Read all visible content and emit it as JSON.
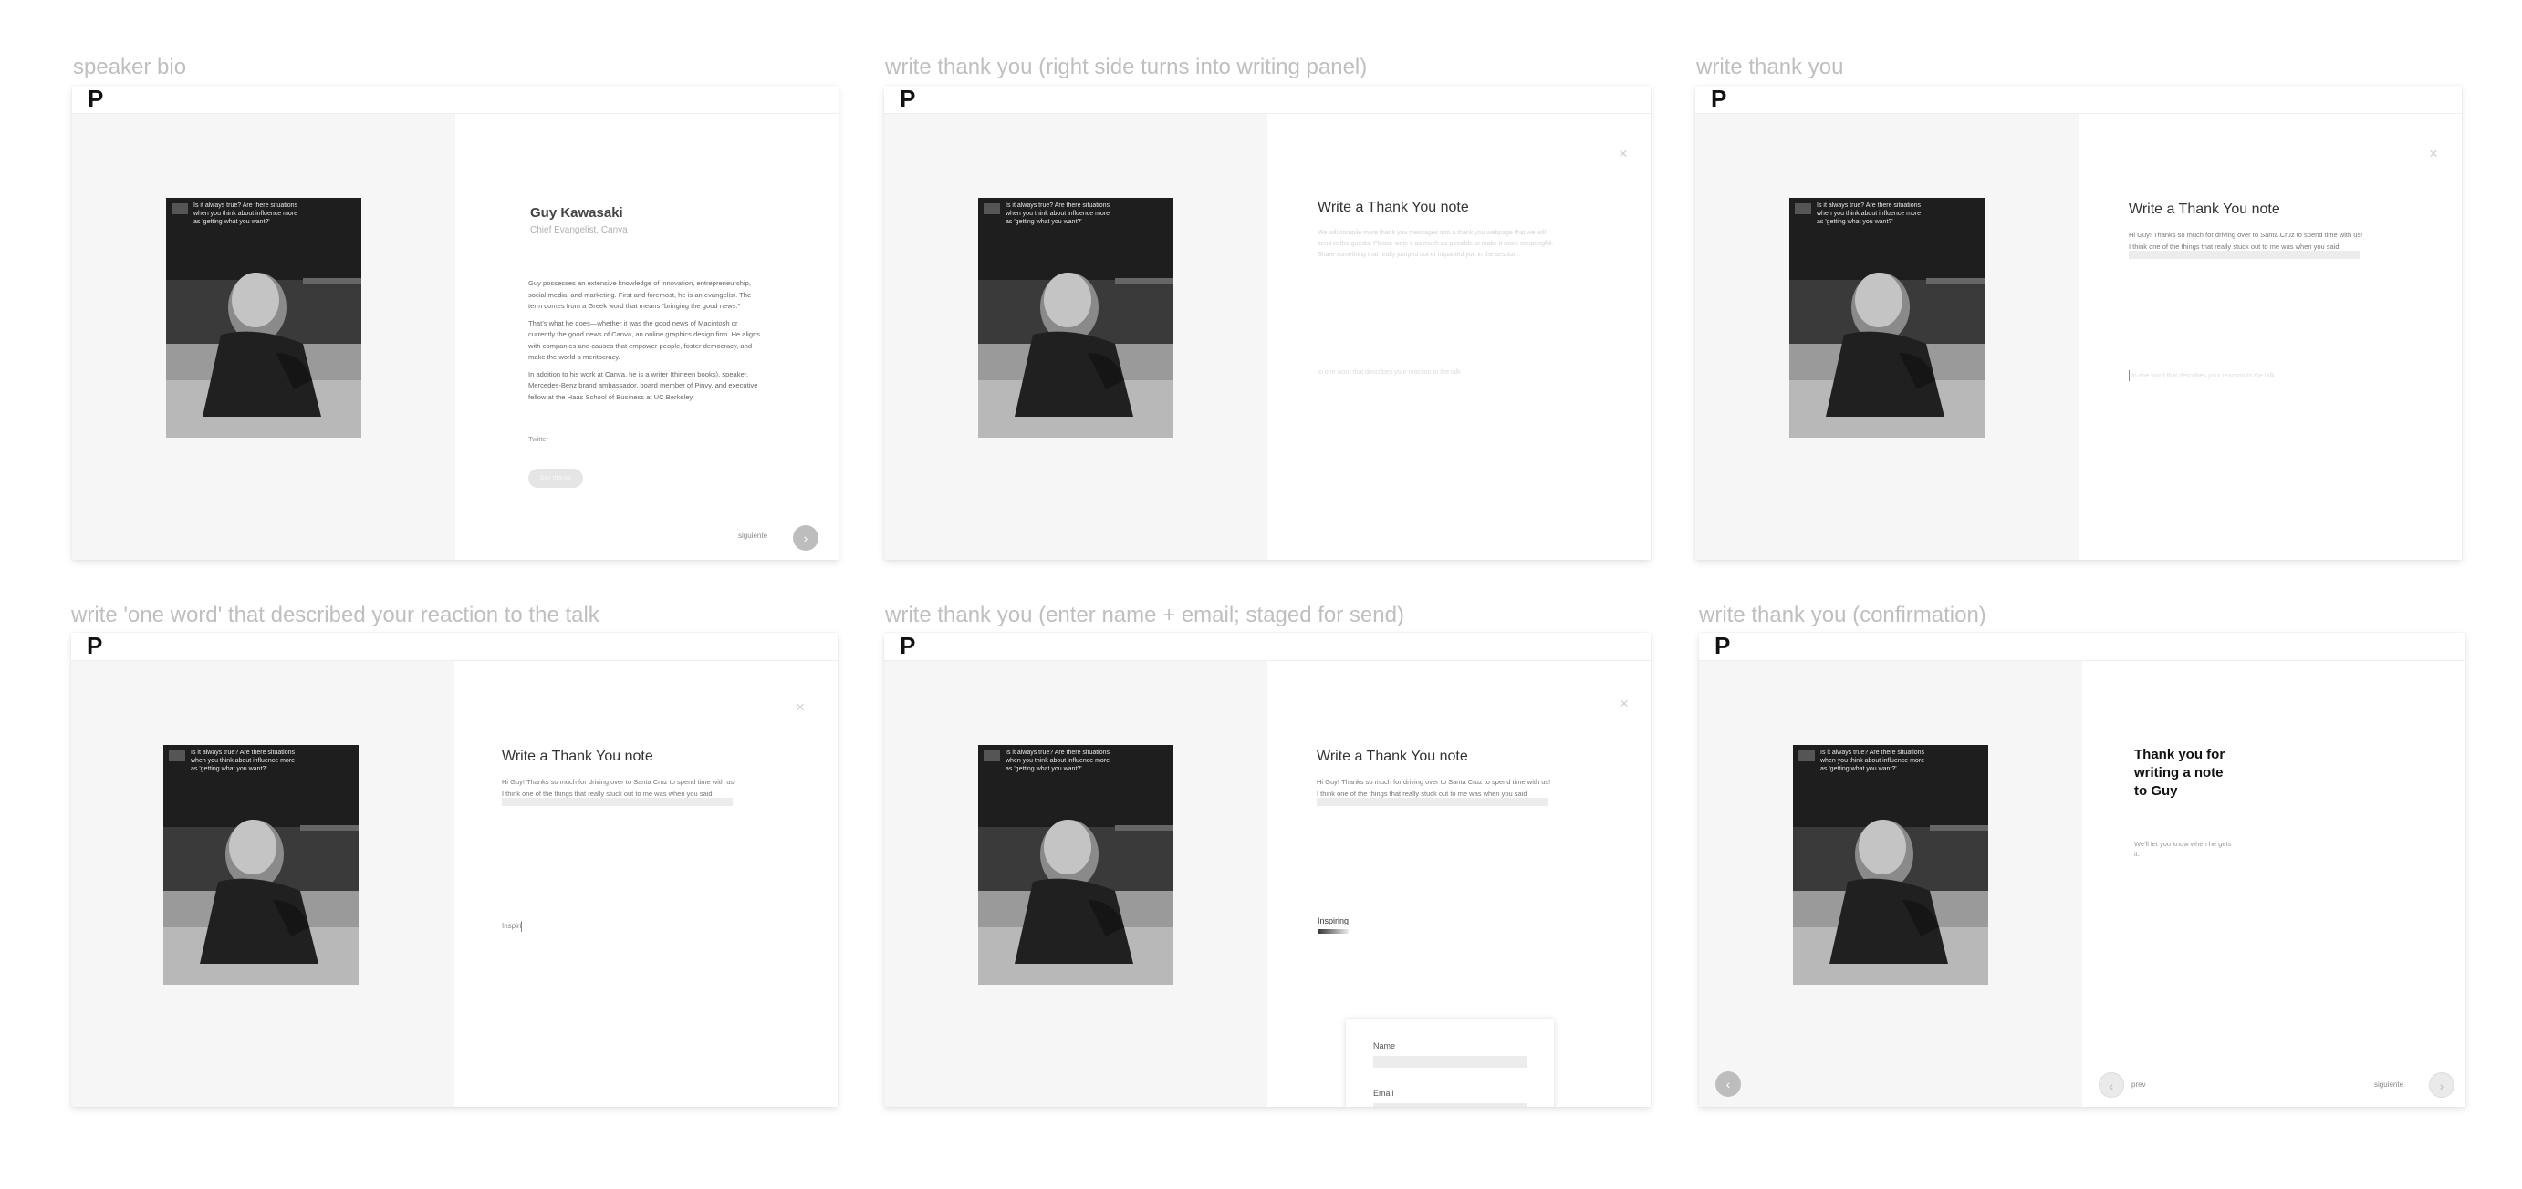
{
  "frames": [
    {
      "label": "speaker bio",
      "logo": "P"
    },
    {
      "label": "write thank you (right side turns into writing panel)",
      "logo": "P"
    },
    {
      "label": "write thank you",
      "logo": "P"
    },
    {
      "label": "write 'one word' that described your reaction to the talk",
      "logo": "P"
    },
    {
      "label": "write thank you (enter name + email; staged for send)",
      "logo": "P"
    },
    {
      "label": "write thank you (confirmation)",
      "logo": "P"
    }
  ],
  "photo": {
    "screen_caption": "Is it always true? Are there situations when you think about influence more as 'getting what you want?'",
    "alt": "Speaker photo"
  },
  "speaker": {
    "name": "Guy Kawasaki",
    "title": "Chief Evangelist, Canva",
    "bio": [
      "Guy possesses an extensive knowledge of innovation, entrepreneurship, social media, and marketing. First and foremost, he is an evangelist. The term comes from a Greek word that means “bringing the good news.”",
      "That’s what he does—whether it was the good news of Macintosh or currently the good news of Canva, an online graphics design firm. He aligns with companies and causes that empower people, foster democracy, and make the world a meritocracy.",
      "In addition to his work at Canva, he is a writer (thirteen books), speaker, Mercedes-Benz brand ambassador, board member of Pinvy, and executive fellow at the Haas School of Business at UC Berkeley."
    ],
    "twitter_label": "Twitter",
    "follow_label": "Say thanks"
  },
  "nav": {
    "next_label": "siguiente",
    "prev_label": "prev",
    "next_icon": "chevron-right",
    "prev_icon": "chevron-left"
  },
  "thank_you": {
    "title": "Write a Thank You note",
    "close_icon": "close",
    "placeholder": "We will compile more thank you messages into a thank you webpage that we will send to the guests. Please write it as much as possible to make it more meaningful. Share something that really jumped out or impacted you in the session.",
    "message": "Hi Guy! Thanks so much for driving over to Santa Cruz to spend time with us! I think one of the things that really stuck out to me was when you said",
    "one_word_placeholder": "In one word that describes your reaction to the talk",
    "one_word_partial": "Inspiri",
    "one_word_full": "Inspiring"
  },
  "send_form": {
    "name_label": "Name",
    "email_label": "Email"
  },
  "confirmation": {
    "title": "Thank you for writing a note to Guy",
    "sub": "We'll let you know when he gets it."
  },
  "colors": {
    "label_text": "#bfbfbf",
    "panel_gray": "#f6f6f6",
    "button_gray": "#bdbdbd",
    "field_gray": "#ececec"
  }
}
